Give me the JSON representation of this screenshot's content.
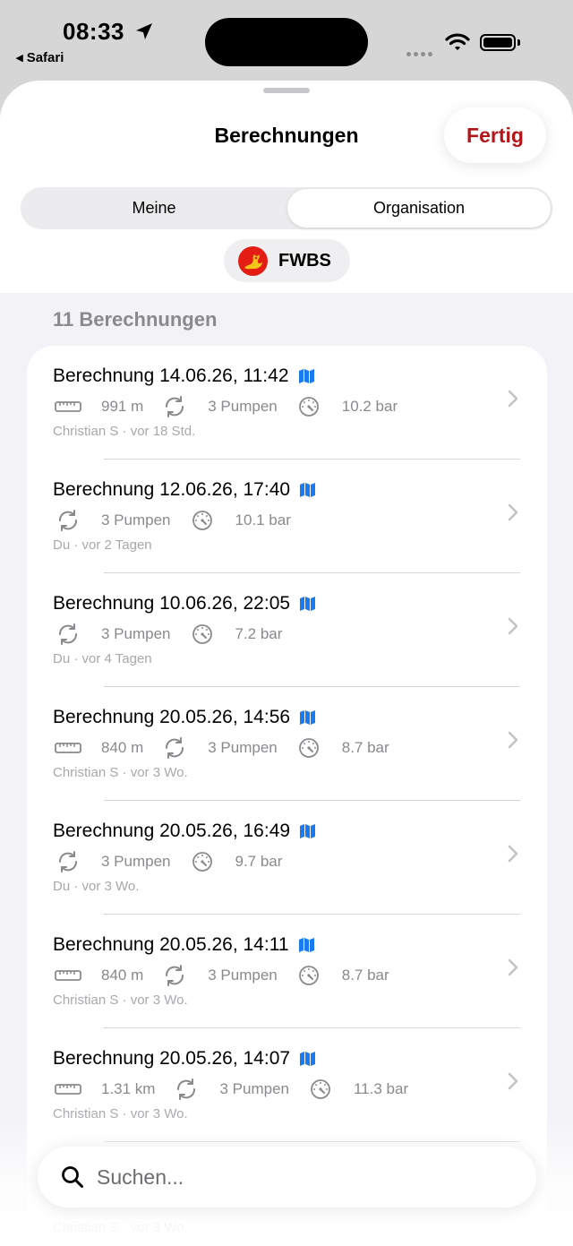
{
  "status_bar": {
    "time": "08:33",
    "back_app": "◂ Safari"
  },
  "sheet": {
    "title": "Berechnungen",
    "done_label": "Fertig",
    "segments": [
      "Meine",
      "Organisation"
    ],
    "selected_segment": "Organisation",
    "org_name": "FWBS"
  },
  "list": {
    "count_label": "11 Berechnungen",
    "rows": [
      {
        "title": "Berechnung 14.06.26, 11:42",
        "distance": "991 m",
        "pumps": "3 Pumpen",
        "pressure": "10.2 bar",
        "author": "Christian S",
        "age": "vor 18 Std."
      },
      {
        "title": "Berechnung 12.06.26, 17:40",
        "distance": "",
        "pumps": "3 Pumpen",
        "pressure": "10.1 bar",
        "author": "Du",
        "age": "vor 2 Tagen"
      },
      {
        "title": "Berechnung 10.06.26, 22:05",
        "distance": "",
        "pumps": "3 Pumpen",
        "pressure": "7.2 bar",
        "author": "Du",
        "age": "vor 4 Tagen"
      },
      {
        "title": "Berechnung 20.05.26, 14:56",
        "distance": "840 m",
        "pumps": "3 Pumpen",
        "pressure": "8.7 bar",
        "author": "Christian S",
        "age": "vor 3 Wo."
      },
      {
        "title": "Berechnung 20.05.26, 16:49",
        "distance": "",
        "pumps": "3 Pumpen",
        "pressure": "9.7 bar",
        "author": "Du",
        "age": "vor 3 Wo."
      },
      {
        "title": "Berechnung 20.05.26, 14:11",
        "distance": "840 m",
        "pumps": "3 Pumpen",
        "pressure": "8.7 bar",
        "author": "Christian S",
        "age": "vor 3 Wo."
      },
      {
        "title": "Berechnung 20.05.26, 14:07",
        "distance": "1.31 km",
        "pumps": "3 Pumpen",
        "pressure": "11.3 bar",
        "author": "Christian S",
        "age": "vor 3 Wo."
      },
      {
        "title": "",
        "distance": "",
        "pumps": "",
        "pressure": "",
        "author": "Christian S",
        "age": "vor 3 Wo."
      }
    ],
    "separator_dot": "·"
  },
  "search": {
    "placeholder": "Suchen..."
  },
  "colors": {
    "accent_red": "#b3151b",
    "map_blue": "#1a7bf0",
    "secondary_text": "#8a8a8e",
    "background": "#f2f2f7"
  },
  "icons": {
    "distance": "ruler-icon",
    "pumps": "arrows-cycle-icon",
    "pressure": "gauge-icon",
    "map": "map-icon",
    "chevron": "chevron-right-icon",
    "search": "magnifier-icon"
  }
}
